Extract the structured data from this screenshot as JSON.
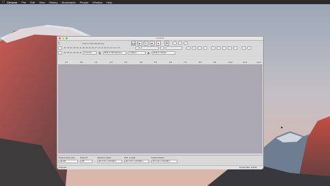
{
  "menubar": {
    "apple": "",
    "app": "Chrome",
    "items": [
      "File",
      "Edit",
      "View",
      "History",
      "Bookmarks",
      "People",
      "Window",
      "Help"
    ]
  },
  "window": {
    "title": "Audacity",
    "toolbar": {
      "click_monitor": "Click to Start Monitoring",
      "meter_scale_top": "-57 -54 -51 -48 -45 -42 -3 0",
      "meter_scale_bottom": "-57 -54 -51 -48 -45 -42 -39 -36 -33 -30 -27 -24 -21 -18 -15 -12 -9 -6 -3 0",
      "host_select": "Core Au...",
      "rec_device": "Built-in Microphone",
      "channels": "2 (Stere...",
      "play_device": "Built-in Output",
      "transport": {
        "pause": "❚❚",
        "play": "▶",
        "loop": "↻",
        "stop": "■",
        "skip_start": "⏮",
        "skip_end": "⏭",
        "record": "●"
      }
    },
    "ruler": {
      "ticks": [
        "1.0",
        "0.0",
        "1.0",
        "2.0",
        "3.0",
        "4.0",
        "5.0",
        "6.0",
        "7.0",
        "8.0",
        "9.0",
        "10.0",
        "11.0",
        "12.0"
      ]
    },
    "bottom": {
      "project_rate_label": "Project Rate (Hz):",
      "project_rate_value": "44100",
      "snap_to_label": "Snap-To",
      "snap_to_value": "Off",
      "selection_start_label": "Selection Start:",
      "selection_start_value": "00 h 00 m 00.000 s",
      "end_label": "End",
      "length_label": "Length",
      "end_value": "00 h 00 m 00.000 s",
      "audio_position_label": "Audio Position:",
      "audio_position_value": "00 h 00 m 00.000 s"
    },
    "status": {
      "left": "Stopped.",
      "right": "Actual Rate: 44100"
    }
  },
  "colors": {
    "track_bg": "#aba8b3",
    "window_bg": "#d9d9d9",
    "record": "#cc2222",
    "play": "#2e9e3a"
  }
}
